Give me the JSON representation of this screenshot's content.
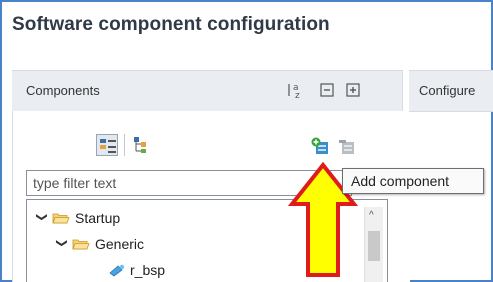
{
  "window": {
    "title": "Software component configuration"
  },
  "components_panel": {
    "title": "Components",
    "sort_icon": "sort-alpha-icon",
    "collapse_icon": "collapse-all-icon",
    "expand_icon": "expand-all-icon"
  },
  "configure_panel": {
    "title": "Configure"
  },
  "toolbar": {
    "view1_icon": "tree-view-icon",
    "view2_icon": "flat-view-icon",
    "add_icon": "add-component-icon",
    "remove_icon": "remove-component-icon"
  },
  "filter": {
    "placeholder": "type filter text"
  },
  "tree": [
    {
      "label": "Startup",
      "expanded": true
    },
    {
      "label": "Generic",
      "expanded": true
    },
    {
      "label": "r_bsp"
    }
  ],
  "tooltip": {
    "text": "Add component"
  },
  "colors": {
    "arrow_fill": "#ffff00",
    "arrow_stroke": "#e01b1b",
    "frame": "#4a82c8"
  }
}
